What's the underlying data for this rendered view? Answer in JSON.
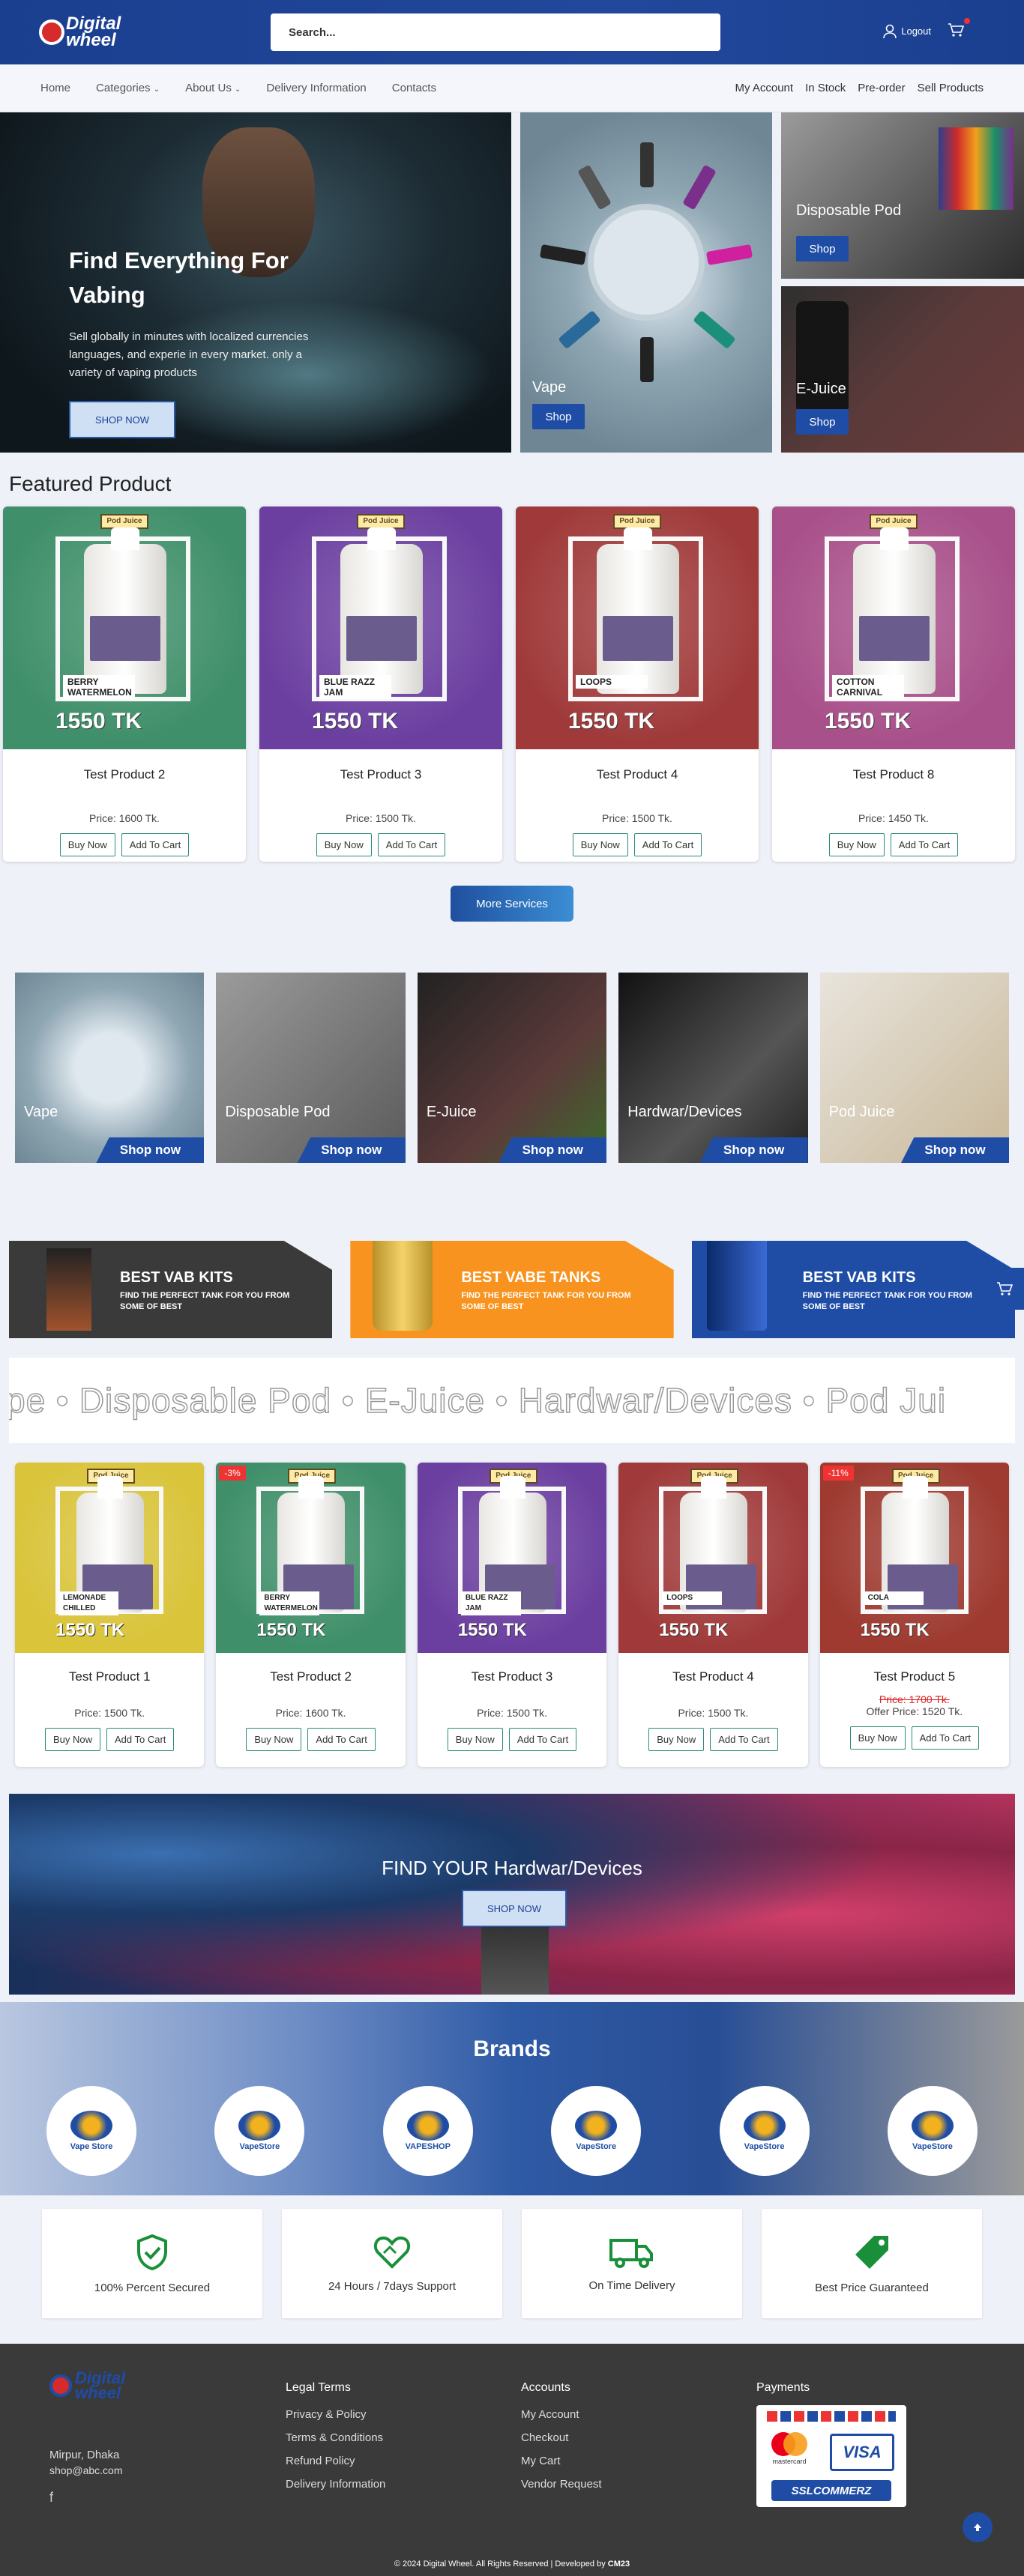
{
  "header": {
    "logo_line1": "Digital",
    "logo_line2": "wheel",
    "search_placeholder": "Search...",
    "logout_label": "Logout"
  },
  "nav": {
    "left": [
      "Home",
      "Categories",
      "About Us",
      "Delivery Information",
      "Contacts"
    ],
    "right": [
      "My Account",
      "In Stock",
      "Pre-order",
      "Sell Products"
    ]
  },
  "hero": {
    "title": "Find Everything For Vabing",
    "text": "Sell globally in minutes with localized currencies languages, and experie in every market. only a variety of vaping products",
    "button": "SHOP NOW",
    "tiles": [
      {
        "label": "Vape",
        "button": "Shop"
      },
      {
        "label": "Disposable Pod",
        "button": "Shop"
      },
      {
        "label": "E-Juice",
        "button": "Shop"
      }
    ]
  },
  "featured": {
    "title": "Featured Product",
    "products": [
      {
        "name": "Test Product 2",
        "price": "Price: 1600 Tk.",
        "flavor": "BERRY WATERMELON",
        "tag": "1550 TK",
        "color": "#3f8f6a"
      },
      {
        "name": "Test Product 3",
        "price": "Price: 1500 Tk.",
        "flavor": "BLUE RAZZ JAM",
        "tag": "1550 TK",
        "color": "#6b3fa0"
      },
      {
        "name": "Test Product 4",
        "price": "Price: 1500 Tk.",
        "flavor": "LOOPS",
        "tag": "1550 TK",
        "color": "#a03a3a"
      },
      {
        "name": "Test Product 8",
        "price": "Price: 1450 Tk.",
        "flavor": "COTTON CARNIVAL",
        "tag": "1550 TK",
        "color": "#a8508a"
      }
    ],
    "buy_label": "Buy Now",
    "cart_label": "Add To Cart",
    "more_label": "More Services"
  },
  "categories": [
    {
      "label": "Vape",
      "button": "Shop now"
    },
    {
      "label": "Disposable Pod",
      "button": "Shop now"
    },
    {
      "label": "E-Juice",
      "button": "Shop now"
    },
    {
      "label": "Hardwar/Devices",
      "button": "Shop now"
    },
    {
      "label": "Pod Juice",
      "button": "Shop now"
    }
  ],
  "kits": [
    {
      "title": "BEST VAB KITS",
      "sub": "FIND THE PERFECT TANK FOR YOU FROM SOME OF BEST",
      "color": "#3a3a3a"
    },
    {
      "title": "BEST VABE TANKS",
      "sub": "FIND THE PERFECT TANK FOR YOU FROM SOME OF BEST",
      "color": "#f7931e"
    },
    {
      "title": "BEST VAB KITS",
      "sub": "FIND THE PERFECT TANK FOR YOU FROM SOME OF BEST",
      "color": "#1f4da6"
    }
  ],
  "marquee": "pe • Disposable Pod • E-Juice • Hardwar/Devices • Pod Jui",
  "products2": [
    {
      "name": "Test Product 1",
      "price": "Price: 1500 Tk.",
      "flavor": "LEMONADE CHILLED",
      "tag": "1550 TK",
      "color": "#d9c43a",
      "badge": ""
    },
    {
      "name": "Test Product 2",
      "price": "Price: 1600 Tk.",
      "flavor": "BERRY WATERMELON",
      "tag": "1550 TK",
      "color": "#3f8f6a",
      "badge": "-3%"
    },
    {
      "name": "Test Product 3",
      "price": "Price: 1500 Tk.",
      "flavor": "BLUE RAZZ JAM",
      "tag": "1550 TK",
      "color": "#6b3fa0",
      "badge": ""
    },
    {
      "name": "Test Product 4",
      "price": "Price: 1500 Tk.",
      "flavor": "LOOPS",
      "tag": "1550 TK",
      "color": "#a03a3a",
      "badge": ""
    },
    {
      "name": "Test Product 5",
      "price": "Offer Price: 1520 Tk.",
      "old_price": "Price: 1700 Tk.",
      "flavor": "COLA",
      "tag": "1550 TK",
      "color": "#9e3a30",
      "badge": "-11%"
    }
  ],
  "promo": {
    "title": "FIND YOUR Hardwar/Devices",
    "button": "SHOP NOW"
  },
  "brands": {
    "title": "Brands",
    "items": [
      "Vape Store",
      "VapeStore",
      "VAPESHOP",
      "VapeStore",
      "VapeStore",
      "VapeStore"
    ]
  },
  "features": [
    "100% Percent Secured",
    "24 Hours / 7days Support",
    "On Time Delivery",
    "Best Price Guaranteed"
  ],
  "footer": {
    "address": "Mirpur, Dhaka",
    "email": "shop@abc.com",
    "legal_title": "Legal Terms",
    "legal": [
      "Privacy & Policy",
      "Terms & Conditions",
      "Refund Policy",
      "Delivery Information"
    ],
    "accounts_title": "Accounts",
    "accounts": [
      "My Account",
      "Checkout",
      "My Cart",
      "Vendor Request"
    ],
    "payments_title": "Payments",
    "pay_visa": "VISA",
    "pay_mc": "mastercard",
    "pay_ssl": "SSLCOMMERZ",
    "copyright_pre": "© 2024 Digital Wheel. All Rights Reserved | Developed by",
    "copyright_dev": "CM23"
  }
}
